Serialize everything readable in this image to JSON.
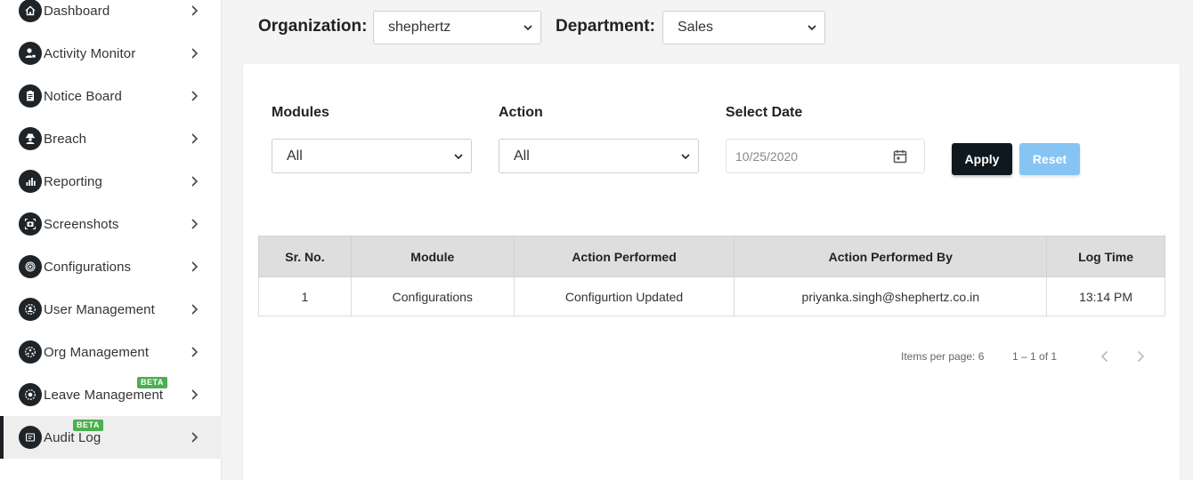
{
  "sidebar": {
    "items": [
      {
        "label": "Dashboard",
        "icon": "home-icon",
        "active": false
      },
      {
        "label": "Activity Monitor",
        "icon": "user-lock-icon",
        "active": false
      },
      {
        "label": "Notice Board",
        "icon": "clipboard-icon",
        "active": false
      },
      {
        "label": "Breach",
        "icon": "spy-icon",
        "active": false
      },
      {
        "label": "Reporting",
        "icon": "bar-chart-icon",
        "active": false
      },
      {
        "label": "Screenshots",
        "icon": "camera-icon",
        "active": false
      },
      {
        "label": "Configurations",
        "icon": "gear-icon",
        "active": false
      },
      {
        "label": "User Management",
        "icon": "user-gear-icon",
        "active": false
      },
      {
        "label": "Org Management",
        "icon": "org-icon",
        "active": false
      },
      {
        "label": "Leave Management",
        "icon": "leave-icon",
        "active": false,
        "badge": "BETA"
      },
      {
        "label": "Audit Log",
        "icon": "audit-log-icon",
        "active": true,
        "badge": "BETA"
      }
    ]
  },
  "topbar": {
    "organization_label": "Organization:",
    "organization_value": "shephertz",
    "department_label": "Department:",
    "department_value": "Sales"
  },
  "filters": {
    "modules_label": "Modules",
    "modules_value": "All",
    "action_label": "Action",
    "action_value": "All",
    "date_label": "Select Date",
    "date_value": "10/25/2020",
    "apply_label": "Apply",
    "reset_label": "Reset"
  },
  "table": {
    "headers": [
      "Sr. No.",
      "Module",
      "Action Performed",
      "Action Performed By",
      "Log Time"
    ],
    "rows": [
      [
        "1",
        "Configurations",
        "Configurtion Updated",
        "priyanka.singh@shephertz.co.in",
        "13:14 PM"
      ]
    ]
  },
  "paginator": {
    "items_per_page": "Items per page: 6",
    "range": "1 – 1 of 1"
  },
  "colors": {
    "apply_bg": "#10181f",
    "reset_bg": "#86c5f3",
    "beta_badge": "#4caf50",
    "header_bg": "#dedede"
  }
}
